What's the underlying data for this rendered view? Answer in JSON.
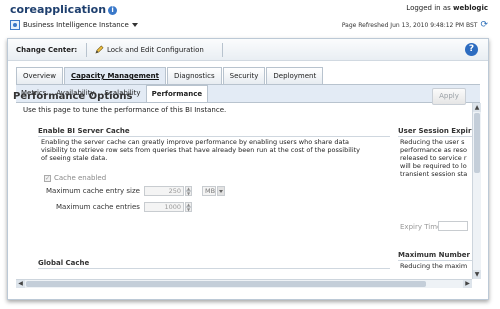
{
  "header": {
    "app_title": "coreapplication",
    "instance_label": "Business Intelligence Instance",
    "logged_in_label": "Logged in as",
    "username": "weblogic",
    "page_refreshed": "Page Refreshed Jun 13, 2010 9:48:12 PM BST"
  },
  "change_center": {
    "label": "Change Center:",
    "lock_button": "Lock and Edit Configuration",
    "help": "?"
  },
  "main_tabs": [
    {
      "label": "Overview"
    },
    {
      "label": "Capacity Management"
    },
    {
      "label": "Diagnostics"
    },
    {
      "label": "Security"
    },
    {
      "label": "Deployment"
    }
  ],
  "sub_tabs": [
    {
      "label": "Metrics"
    },
    {
      "label": "Availability"
    },
    {
      "label": "Scalability"
    },
    {
      "label": "Performance"
    }
  ],
  "page": {
    "title": "Performance Options",
    "description": "Use this page to tune the performance of this BI Instance.",
    "apply_button": "Apply"
  },
  "cache_section": {
    "title": "Enable BI Server Cache",
    "description_lines": [
      "Enabling the server cache can greatly improve performance by enabling users who share data",
      "visibility to retrieve row sets from queries that have already been run at the cost of the possibility",
      "of seeing stale data."
    ],
    "cache_enabled_label": "Cache enabled",
    "cache_enabled": true,
    "max_entry_size_label": "Maximum cache entry size",
    "max_entry_size_value": "250",
    "max_entry_size_unit": "MB",
    "max_entries_label": "Maximum cache entries",
    "max_entries_value": "1000"
  },
  "global_cache_section": {
    "title": "Global Cache"
  },
  "session_section": {
    "title": "User Session Expir",
    "description_lines": [
      "Reducing the user s",
      "performance as reso",
      "released to service r",
      "will be required to lo",
      "transient session sta"
    ],
    "expiry_label": "Expiry Time"
  },
  "max_section": {
    "title": "Maximum Number",
    "description_line": "Reducing the maxim"
  }
}
